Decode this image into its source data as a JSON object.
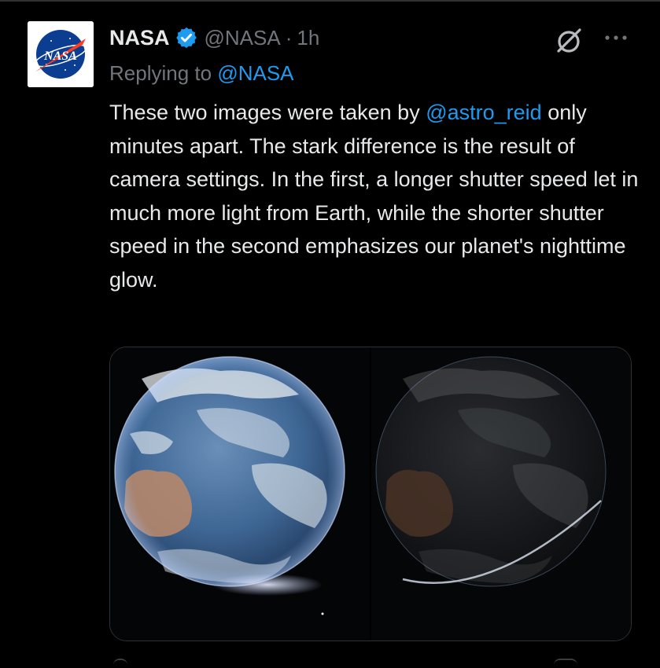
{
  "tweet": {
    "author_name": "NASA",
    "author_handle": "@NASA",
    "separator": "·",
    "time": "1h",
    "verified_icon": "verified-badge-icon",
    "reply_prefix": "Replying to",
    "reply_mention": "@NASA",
    "text_before_mention": "These two images were taken by ",
    "text_mention": "@astro_reid",
    "text_after_mention": " only minutes apart. The stark difference is the result of camera settings. In the first, a longer shutter speed let in much more light from Earth, while the shorter shutter speed in the second emphasizes our planet's nighttime glow.",
    "avatar_logo_text": "NASA",
    "icons": [
      "nasa-logo",
      "verified-badge-icon",
      "grok-icon",
      "more-icon"
    ]
  },
  "media": {
    "photos": [
      {
        "name": "earth-bright-exposure"
      },
      {
        "name": "earth-dark-exposure"
      }
    ]
  },
  "colors": {
    "background": "#000000",
    "text_primary": "#e7e9ea",
    "text_secondary": "#71767b",
    "link": "#1d9bf0",
    "border": "#2f3336"
  }
}
